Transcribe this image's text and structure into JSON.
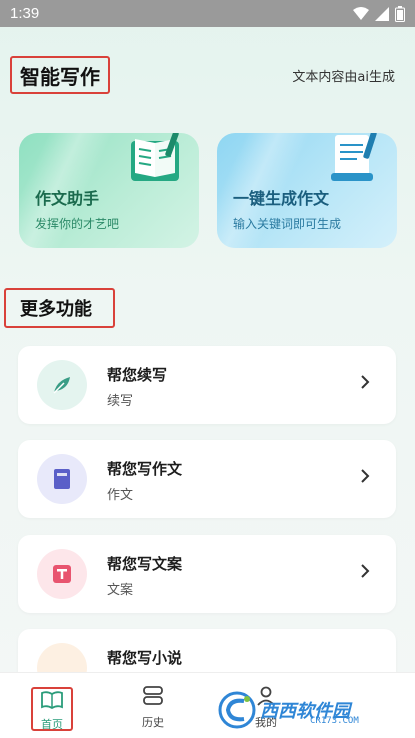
{
  "status_bar": {
    "time": "1:39"
  },
  "header": {
    "title": "智能写作",
    "ai_note": "文本内容由ai生成"
  },
  "cards": [
    {
      "title": "作文助手",
      "subtitle": "发挥你的才艺吧"
    },
    {
      "title": "一键生成作文",
      "subtitle": "输入关键词即可生成"
    }
  ],
  "more": {
    "title": "更多功能"
  },
  "features": [
    {
      "title": "帮您续写",
      "subtitle": "续写",
      "icon": "feather-icon",
      "color": "#3a9d86",
      "bg": "#e4f4ef"
    },
    {
      "title": "帮您写作文",
      "subtitle": "作文",
      "icon": "book-icon",
      "color": "#5a5fc8",
      "bg": "#e8e9fa"
    },
    {
      "title": "帮您写文案",
      "subtitle": "文案",
      "icon": "text-t-icon",
      "color": "#e8546f",
      "bg": "#fde6ea"
    },
    {
      "title": "帮您写小说",
      "subtitle": "",
      "icon": "novel-icon",
      "color": "#e8a04a",
      "bg": "#fdf0e2"
    }
  ],
  "nav": [
    {
      "label": "首页",
      "active": true,
      "color": "#2a9c7a"
    },
    {
      "label": "历史",
      "active": false
    },
    {
      "label": "我的",
      "active": false
    }
  ],
  "watermark": {
    "brand": "西西软件园",
    "url": "CR173.COM"
  }
}
